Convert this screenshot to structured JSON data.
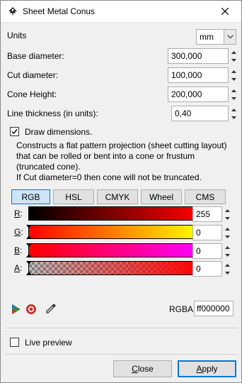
{
  "window": {
    "title": "Sheet Metal Conus"
  },
  "units": {
    "label": "Units",
    "value": "mm"
  },
  "fields": [
    {
      "label": "Base diameter:",
      "value": "300,000"
    },
    {
      "label": "Cut diameter:",
      "value": "100,000"
    },
    {
      "label": "Cone Height:",
      "value": "200,000"
    },
    {
      "label": "Line thickness (in units):",
      "value": "0,40"
    }
  ],
  "draw_dimensions": {
    "label": "Draw dimensions.",
    "checked": true
  },
  "description": {
    "line1": "Constructs a flat pattern projection (sheet cutting layout)",
    "line2": "that can be rolled or bent into a cone or frustum",
    "line3": "(truncated cone).",
    "line4": "If Cut diameter=0 then cone will not be truncated."
  },
  "color_tabs": [
    "RGB",
    "HSL",
    "CMYK",
    "Wheel",
    "CMS"
  ],
  "active_color_tab": "RGB",
  "sliders": [
    {
      "key": "R",
      "label_rest": ":",
      "value": "255"
    },
    {
      "key": "G",
      "label_rest": ":",
      "value": "0"
    },
    {
      "key": "B",
      "label_rest": ":",
      "value": "0"
    },
    {
      "key": "A",
      "label_rest": ":",
      "value": "0"
    }
  ],
  "rgba": {
    "label": "RGBA:",
    "value": "ff000000"
  },
  "live_preview": {
    "label": "Live preview",
    "checked": false
  },
  "buttons": {
    "close": {
      "mnemonic": "C",
      "rest": "lose"
    },
    "apply": {
      "mnemonic": "A",
      "rest": "pply"
    }
  },
  "colors": {
    "accent": "#0078d7",
    "tab_active_bg": "#cce4f7",
    "red": "#ff0000"
  },
  "icons": [
    "inkscape-icon",
    "close-icon",
    "dropdown-chevron-icon",
    "spin-up-icon",
    "spin-down-icon",
    "checkmark-icon",
    "color-managed-icon",
    "out-of-gamut-icon",
    "eyedropper-icon"
  ]
}
